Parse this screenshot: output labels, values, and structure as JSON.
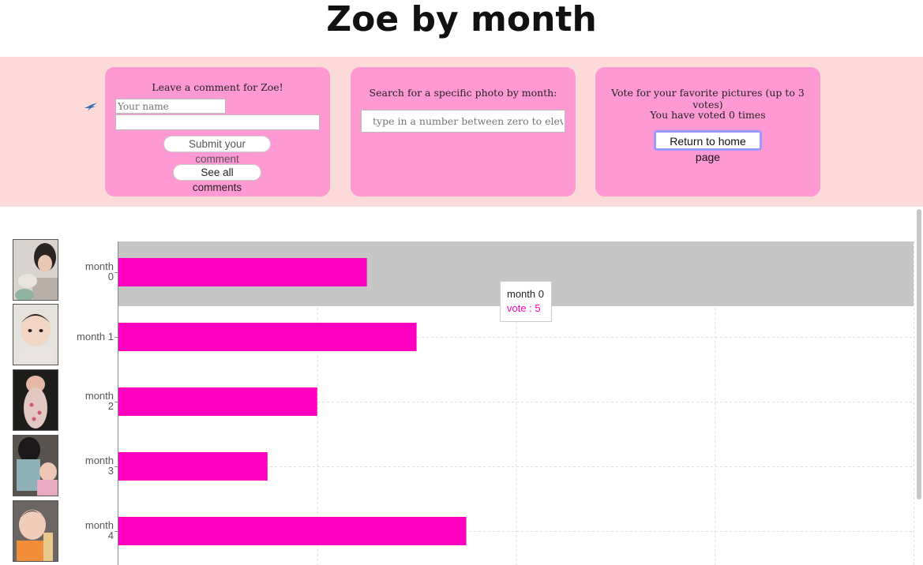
{
  "header": {
    "title": "Zoe by month"
  },
  "comment_card": {
    "heading": "Leave a comment for Zoe!",
    "name_placeholder": "Your name",
    "comment_value": "",
    "submit_label": "Submit your comment",
    "see_all_label": "See all comments"
  },
  "search_card": {
    "heading": "Search for a specific photo by month:",
    "placeholder": "type in a number between zero to eleven"
  },
  "vote_card": {
    "heading": "Vote for your favorite pictures (up to 3 votes)",
    "vote_status": "You have voted 0 times",
    "home_label": "Return to home page"
  },
  "tooltip": {
    "title": "month 0",
    "value": "vote : 5"
  },
  "colors": {
    "bar": "#ff00c0",
    "card": "#ff99d4",
    "band": "#fddada",
    "highlight": "#c6c6c6"
  },
  "chart_data": {
    "type": "bar",
    "orientation": "horizontal",
    "categories": [
      "month 0",
      "month 1",
      "month 2",
      "month 3",
      "month 4"
    ],
    "series": [
      {
        "values": [
          5,
          6,
          4,
          3,
          7
        ]
      }
    ],
    "xlim": [
      0,
      16
    ],
    "grid": true,
    "highlighted": "month 0"
  },
  "thumbnails": [
    "photo-month-0",
    "photo-month-1",
    "photo-month-2",
    "photo-month-3",
    "photo-month-4"
  ]
}
